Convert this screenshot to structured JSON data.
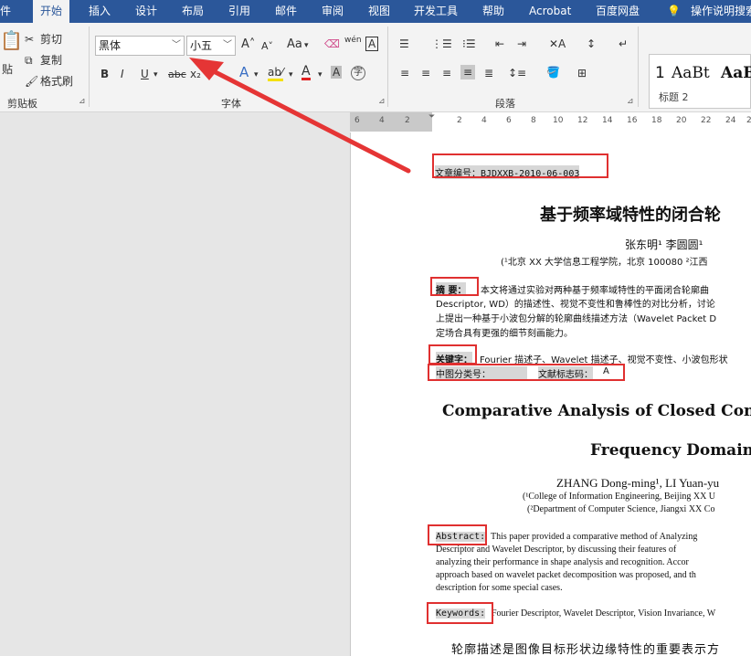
{
  "tabs": [
    {
      "label": "件"
    },
    {
      "label": "开始"
    },
    {
      "label": "插入"
    },
    {
      "label": "设计"
    },
    {
      "label": "布局"
    },
    {
      "label": "引用"
    },
    {
      "label": "邮件"
    },
    {
      "label": "审阅"
    },
    {
      "label": "视图"
    },
    {
      "label": "开发工具"
    },
    {
      "label": "帮助"
    },
    {
      "label": "Acrobat"
    },
    {
      "label": "百度网盘"
    },
    {
      "label": "操作说明搜索"
    }
  ],
  "clipboard": {
    "cut": "剪切",
    "copy": "复制",
    "format_painter": "格式刷",
    "paste": "贴",
    "group_label": "剪贴板"
  },
  "font": {
    "name": "黑体",
    "size": "小五",
    "group_label": "字体",
    "aa": "Aa",
    "bold": "B",
    "italic": "I",
    "underline": "U",
    "strike": "abc",
    "sub": "x₂",
    "text_effect": "A",
    "font_color": "A",
    "char_shade": "A",
    "phonetic": "wén",
    "enclose": "字",
    "border_a": "A"
  },
  "paragraph": {
    "group_label": "段落"
  },
  "styles": {
    "preview1": "AaBt",
    "name1": "标题 2",
    "num": "1",
    "preview2": "AaBt"
  },
  "ruler": [
    "6",
    "4",
    "2",
    "2",
    "4",
    "6",
    "8",
    "10",
    "12",
    "14",
    "16",
    "18",
    "20",
    "22",
    "24",
    "2"
  ],
  "doc": {
    "article_no": "文章编号：BJDXXB-2010-06-003",
    "title_cn": "基于频率域特性的闭合轮",
    "authors_cn": "张东明¹  李圆圆¹  ",
    "affil_cn": "(¹北京 XX 大学信息工程学院，北京  100080    ²江西",
    "abstract_label": "摘    要：",
    "abstract_1": "本文将通过实验对两种基于频率域特性的平面闭合轮廓曲",
    "abstract_2": "Descriptor, WD）的描述性、视觉不变性和鲁棒性的对比分析，讨论",
    "abstract_3": "上提出一种基于小波包分解的轮廓曲线描述方法（Wavelet Packet D",
    "abstract_4": "定场合具有更强的细节刻画能力。",
    "keywords_label": "关键字：",
    "keywords_text": "Fourier 描述子、Wavelet 描述子、视觉不变性、小波包形状",
    "class_label": "中图分类号：",
    "doc_code_label": "文献标志码：",
    "doc_code_value": "A",
    "title_en_1": "Comparative Analysis of Closed Con",
    "title_en_2": "Frequency Domain",
    "authors_en": "ZHANG Dong-ming¹, LI Yuan-yu",
    "affil_en_1": "(¹College of Information Engineering, Beijing XX U",
    "affil_en_2": "(²Department of Computer Science, Jiangxi XX Co",
    "abstract_en_label": "Abstract:",
    "abstract_en_1": "This paper provided a comparative method of Analyzing",
    "abstract_en_2": "Descriptor and Wavelet Descriptor, by discussing their features of",
    "abstract_en_3": "analyzing their performance in shape analysis and recognition. Accor",
    "abstract_en_4": "approach based on wavelet packet decomposition was proposed, and th",
    "abstract_en_5": "description for some special cases.",
    "keywords_en_label": "Keywords:",
    "keywords_en_text": "Fourier Descriptor, Wavelet Descriptor, Vision Invariance, W",
    "body_start": "轮廓描述是图像目标形状边缘特性的重要表示方"
  },
  "colors": {
    "ribbon_blue": "#2b579a",
    "annotation_red": "#e03030",
    "highlight_gray": "#d7d7d7"
  }
}
